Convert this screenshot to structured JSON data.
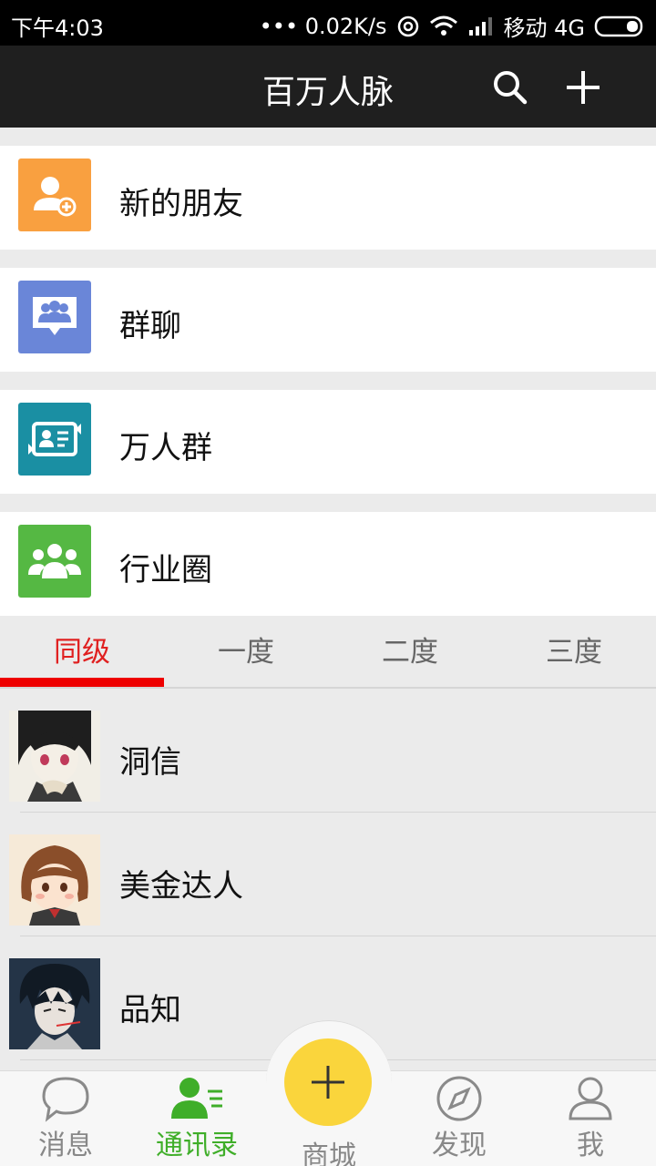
{
  "status_bar": {
    "time": "下午4:03",
    "speed": "••• 0.02K/s",
    "carrier": "移动 4G"
  },
  "header": {
    "title": "百万人脉",
    "search_icon": "search-icon",
    "add_icon": "plus-icon"
  },
  "menu": [
    {
      "label": "新的朋友",
      "icon": "add-friend-icon",
      "color": "#f9a040"
    },
    {
      "label": "群聊",
      "icon": "group-chat-icon",
      "color": "#6a86d8"
    },
    {
      "label": "万人群",
      "icon": "mass-group-icon",
      "color": "#1a8fa3"
    },
    {
      "label": "行业圈",
      "icon": "industry-circle-icon",
      "color": "#55b843"
    }
  ],
  "tabs": [
    {
      "label": "同级",
      "active": true
    },
    {
      "label": "一度",
      "active": false
    },
    {
      "label": "二度",
      "active": false
    },
    {
      "label": "三度",
      "active": false
    }
  ],
  "contacts": [
    {
      "name": "洞信"
    },
    {
      "name": "美金达人"
    },
    {
      "name": "品知"
    }
  ],
  "bottom_nav": [
    {
      "label": "消息",
      "icon": "chat-bubble-icon"
    },
    {
      "label": "通讯录",
      "icon": "contacts-icon",
      "active": true
    },
    {
      "label": "商城",
      "icon": "plus-icon"
    },
    {
      "label": "发现",
      "icon": "compass-icon"
    },
    {
      "label": "我",
      "icon": "person-icon"
    }
  ],
  "colors": {
    "active_tab": "#e02020",
    "active_nav": "#3fae29",
    "fab": "#fad53c",
    "header_bg": "#1f1f1f"
  }
}
